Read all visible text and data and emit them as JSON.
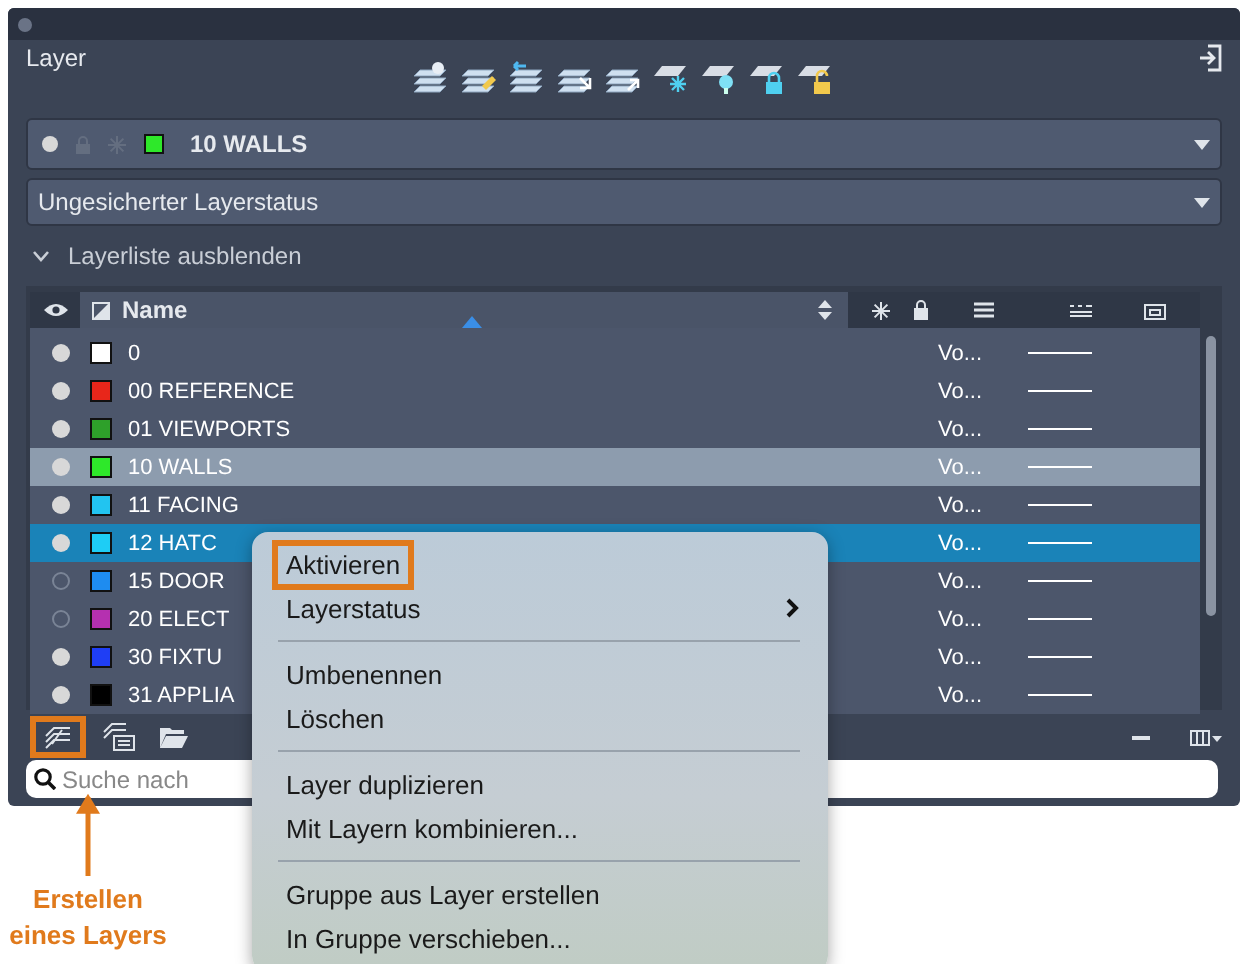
{
  "panel": {
    "title": "Layer"
  },
  "current_layer": {
    "name": "10 WALLS",
    "color": "#2ee82a",
    "visible": true
  },
  "layer_state": {
    "value": "Ungesicherter Layerstatus"
  },
  "list_toggle": {
    "label": "Layerliste ausblenden",
    "expanded": true
  },
  "table": {
    "columns": [
      {
        "label": "Name"
      }
    ],
    "rows": [
      {
        "name": "0",
        "color": "#ffffff",
        "visible": true,
        "current": false,
        "selected": false,
        "column_3": "Vo..."
      },
      {
        "name": "00 REFERENCE",
        "color": "#e8261a",
        "visible": true,
        "current": false,
        "selected": false,
        "column_3": "Vo..."
      },
      {
        "name": "01 VIEWPORTS",
        "color": "#2ea02a",
        "visible": true,
        "current": false,
        "selected": false,
        "column_3": "Vo..."
      },
      {
        "name": "10 WALLS",
        "color": "#2ee82a",
        "visible": true,
        "current": true,
        "selected": false,
        "column_3": "Vo..."
      },
      {
        "name": "11 FACING",
        "color": "#22c4f0",
        "visible": true,
        "current": false,
        "selected": false,
        "column_3": "Vo..."
      },
      {
        "name": "12 HATC",
        "color": "#1ecdf5",
        "visible": true,
        "current": false,
        "selected": true,
        "column_3": "Vo..."
      },
      {
        "name": "15 DOOR",
        "color": "#1e8cf0",
        "visible": false,
        "current": false,
        "selected": false,
        "column_3": "Vo..."
      },
      {
        "name": "20 ELECT",
        "color": "#b530b0",
        "visible": false,
        "current": false,
        "selected": false,
        "column_3": "Vo..."
      },
      {
        "name": "30 FIXTU",
        "color": "#1f3ef5",
        "visible": true,
        "current": false,
        "selected": false,
        "column_3": "Vo..."
      },
      {
        "name": "31 APPLIA",
        "color": "#000000",
        "visible": true,
        "current": false,
        "selected": false,
        "column_3": "Vo..."
      }
    ]
  },
  "search": {
    "placeholder": "Suche nach"
  },
  "context_menu": {
    "items": [
      {
        "kind": "item",
        "label": "Aktivieren",
        "submenu": false,
        "marked": true
      },
      {
        "kind": "item",
        "label": "Layerstatus",
        "submenu": true,
        "marked": false
      },
      {
        "kind": "separator"
      },
      {
        "kind": "item",
        "label": "Umbenennen",
        "submenu": false,
        "marked": false
      },
      {
        "kind": "item",
        "label": "Löschen",
        "submenu": false,
        "marked": false
      },
      {
        "kind": "separator"
      },
      {
        "kind": "item",
        "label": "Layer duplizieren",
        "submenu": false,
        "marked": false
      },
      {
        "kind": "item",
        "label": "Mit Layern kombinieren...",
        "submenu": false,
        "marked": false
      },
      {
        "kind": "separator"
      },
      {
        "kind": "item",
        "label": "Gruppe aus Layer erstellen",
        "submenu": false,
        "marked": false
      },
      {
        "kind": "item",
        "label": "In Gruppe verschieben...",
        "submenu": false,
        "marked": false
      }
    ]
  },
  "callout": {
    "text": "Erstellen eines Layers"
  }
}
